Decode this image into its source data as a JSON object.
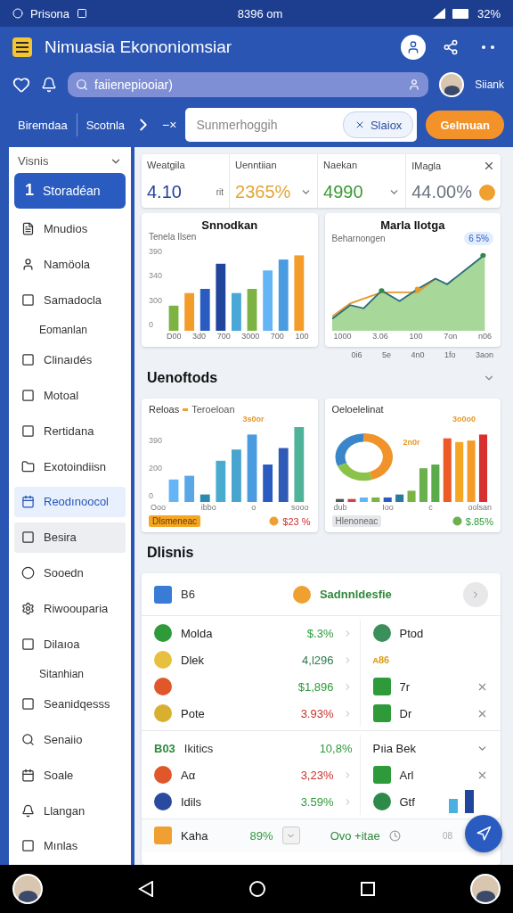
{
  "status_bar": {
    "carrier": "Prisona",
    "time": "8396 om",
    "battery": "32%"
  },
  "app_bar": {
    "title": "Nimuasia Ekononiomsiar"
  },
  "search": {
    "placeholder": "faiienepiooiar)",
    "user": "Siiank"
  },
  "toolbar": {
    "crumbs": [
      "Biremdaa",
      "Scotnla"
    ],
    "clear": "−×",
    "field_placeholder": "Sunmerhoggih",
    "chip": "Slaiox",
    "action": "Gelmuan"
  },
  "sidebar": {
    "header": "Visnis",
    "items": [
      {
        "kind": "primary",
        "number": "1",
        "label": "Storadéan",
        "selected": true,
        "hovered": false
      },
      {
        "kind": "item",
        "label": "Mnudios",
        "selected": false,
        "hovered": false
      },
      {
        "kind": "item",
        "label": "Namöola",
        "selected": false,
        "hovered": false
      },
      {
        "kind": "item",
        "label": "Samadocla",
        "selected": false,
        "hovered": false
      },
      {
        "kind": "sub",
        "label": "Eomanlan",
        "selected": false,
        "hovered": false
      },
      {
        "kind": "item",
        "label": "Clinaıdés",
        "selected": false,
        "hovered": false
      },
      {
        "kind": "item",
        "label": "Motoal",
        "selected": false,
        "hovered": false
      },
      {
        "kind": "item",
        "label": "Rertidana",
        "selected": false,
        "hovered": false
      },
      {
        "kind": "item",
        "label": "Exotoindiisn",
        "selected": false,
        "hovered": false
      },
      {
        "kind": "item",
        "label": "Reodınoocol",
        "selected": true,
        "hovered": false
      },
      {
        "kind": "item",
        "label": "Besira",
        "selected": false,
        "hovered": true
      },
      {
        "kind": "item",
        "label": "Sooedn",
        "selected": false,
        "hovered": false
      },
      {
        "kind": "item",
        "label": "Riwoouparia",
        "selected": false,
        "hovered": false
      },
      {
        "kind": "item",
        "label": "Dilaıoa",
        "selected": false,
        "hovered": false
      },
      {
        "kind": "sub",
        "label": "Sitanhian",
        "selected": false,
        "hovered": false
      },
      {
        "kind": "item",
        "label": "Seanidqesss",
        "selected": false,
        "hovered": false
      },
      {
        "kind": "item",
        "label": "Senaiio",
        "selected": false,
        "hovered": false
      },
      {
        "kind": "item",
        "label": "Soale",
        "selected": false,
        "hovered": false
      },
      {
        "kind": "item",
        "label": "Llangan",
        "selected": false,
        "hovered": false
      },
      {
        "kind": "item",
        "label": "Mınlas",
        "selected": false,
        "hovered": false
      }
    ]
  },
  "stats": [
    {
      "label": "Weatgila",
      "value": "4.10",
      "color": "#23449a",
      "kind": "unit",
      "unit": "rit"
    },
    {
      "label": "Uenntiian",
      "value": "2365%",
      "color": "#e2a637",
      "kind": "chevron"
    },
    {
      "label": "Naekan",
      "value": "4990",
      "color": "#3a9a35",
      "kind": "chevron"
    },
    {
      "label": "IMagla",
      "value": "44.00%",
      "color": "#6b7280",
      "kind": "badge"
    }
  ],
  "charts_top": [
    {
      "kind": "bars",
      "title": "Snnodkan",
      "subtitle": "Tenela Ilsen",
      "yticks": [
        "390",
        "340",
        "300",
        "0"
      ],
      "xticks": [
        "D00",
        "3d0",
        "700",
        "3000",
        "700",
        "100"
      ]
    },
    {
      "kind": "line",
      "title": "Marla Ilotga",
      "subtitle": "Beharnongen",
      "badge": "6 5%",
      "xticks": [
        "1000",
        "3.06",
        "100",
        "7on",
        "n06"
      ],
      "xticks2": [
        "0i6",
        "5e",
        "4n0",
        "1fo",
        "3aon"
      ]
    }
  ],
  "section_1": {
    "title": "Uenoftods"
  },
  "charts_mid": [
    {
      "kind": "bars",
      "title": "Reloas",
      "legend": "Teroeloan",
      "peak": "3s0or",
      "yticks": [
        "390",
        "200",
        "0"
      ],
      "xticks": [
        "Ooo",
        "ibbo",
        "o",
        "sooo"
      ],
      "tag": "Dlsmeneac",
      "delta": "$23 %",
      "color": "#c8312c"
    },
    {
      "kind": "donut",
      "title": "Oeloelelinat",
      "peak": "3o0o0",
      "peak2": "2n0r",
      "xticks": [
        "dub",
        "Ioo",
        "c",
        "oolsan"
      ],
      "tag": "Hlenoneac",
      "delta": "$.85%",
      "color": "#2e9a3a"
    }
  ],
  "section_2": {
    "title": "Dlisnis"
  },
  "table": {
    "head_left": "B6",
    "head_mid": "Sadnnldesfie",
    "rows": [
      {
        "label": "Molda",
        "value": "$.3%",
        "color": "#2e9a3a",
        "kind": "plain",
        "other": "Ptod"
      },
      {
        "label": "Dlek",
        "value": "4,l296",
        "color": "#2a7a4a",
        "kind": "tag",
        "other": "ᴀ86"
      },
      {
        "value": "$1,896",
        "color": "#2e9a3a",
        "kind": "close",
        "other": "7r"
      },
      {
        "label": "Pote",
        "value": "3.93%",
        "color": "#c8312c",
        "kind": "close",
        "other": "Dr"
      }
    ],
    "group_code": "B03",
    "group_label": "Ikitics",
    "group_value": "10,8%",
    "group_other": "Pıia Bek",
    "rows2": [
      {
        "label": "Aα",
        "value": "3,23%",
        "color": "#c8312c",
        "kind": "close",
        "other": "Arl"
      },
      {
        "label": "Idils",
        "value": "3.59%",
        "color": "#2e9a3a",
        "kind": "bars",
        "other": "Gtf"
      }
    ],
    "footer": {
      "label": "Kaha",
      "value": "89%",
      "note": "Ovo +itae",
      "extra": "08"
    }
  }
}
